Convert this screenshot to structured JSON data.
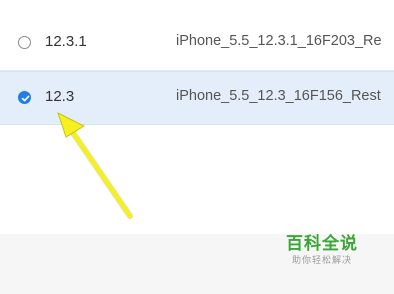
{
  "firmware_list": {
    "rows": [
      {
        "version": "12.3.1",
        "filename": "iPhone_5.5_12.3.1_16F203_Re",
        "selected": false
      },
      {
        "version": "12.3",
        "filename": "iPhone_5.5_12.3_16F156_Rest",
        "selected": true
      }
    ]
  },
  "annotation": {
    "arrow_color": "#f5f01e",
    "arrow_icon": "pointer-arrow-icon"
  },
  "watermark": {
    "main": "百科全说",
    "sub": "助你轻松解决",
    "color": "#3aa636"
  },
  "colors": {
    "selected_row_bg": "#e4eefb",
    "radio_checked": "#1f7ee8"
  }
}
